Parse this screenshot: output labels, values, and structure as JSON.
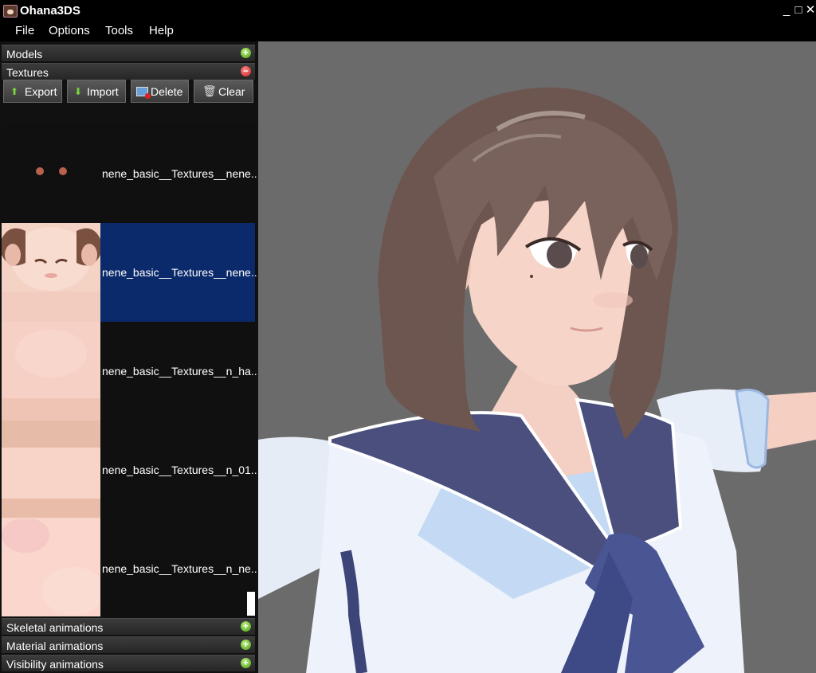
{
  "window": {
    "title": "Ohana3DS",
    "minimize": "_",
    "maximize": "□",
    "close": "✕"
  },
  "menu": [
    "File",
    "Options",
    "Tools",
    "Help"
  ],
  "sections": {
    "models": "Models",
    "textures": "Textures",
    "skeletal": "Skeletal animations",
    "material": "Material animations",
    "visibility": "Visibility animations"
  },
  "toolbar": {
    "export": "Export",
    "import": "Import",
    "delete": "Delete",
    "clear": "Clear"
  },
  "textures": [
    "nene_basic__Textures__nene...",
    "nene_basic__Textures__nene...",
    "nene_basic__Textures__n_ha...",
    "nene_basic__Textures__n_01...",
    "nene_basic__Textures__n_ne..."
  ],
  "selected_texture_index": 1,
  "icons": {
    "section_expand": "plus-circle-icon",
    "section_collapse": "minus-circle-icon",
    "export": "arrow-up-icon",
    "import": "arrow-down-icon",
    "delete": "delete-image-icon",
    "clear": "trash-icon"
  },
  "colors": {
    "selection": "#0b2a6b",
    "viewport_bg": "#6b6b6b"
  }
}
